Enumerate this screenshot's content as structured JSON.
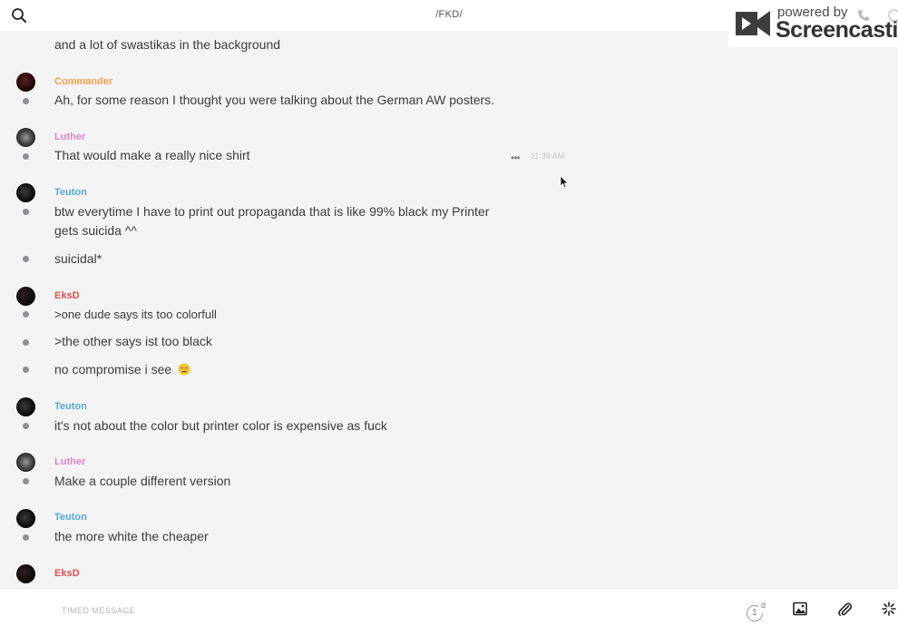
{
  "header": {
    "channel_title": "/FKD/",
    "search_icon": "search-icon"
  },
  "watermark": {
    "powered": "powered by",
    "brand": "Screencastify"
  },
  "messages": [
    {
      "text": "and a lot of swastikas in the background"
    },
    {
      "author": "Commander",
      "color": "#f0a050",
      "lines": [
        "Ah, for some reason I thought you were talking about the German AW posters."
      ]
    },
    {
      "author": "Luther",
      "color": "#d889c4",
      "lines": [
        "That would make a really nice shirt"
      ],
      "time": "11:39 AM"
    },
    {
      "author": "Teuton",
      "color": "#5aa9d6",
      "lines": [
        "btw everytime I have to print out propaganda that is like 99% black my Printer",
        "gets suicida ^^",
        "suicidal*"
      ]
    },
    {
      "author": "EksD",
      "color": "#d9534f",
      "lines": [
        ">one dude says its too colorfull",
        ">the other says ist too black",
        "no compromise i see"
      ]
    },
    {
      "author": "Teuton",
      "color": "#5aa9d6",
      "lines": [
        "it's not about the color but printer color is expensive as fuck"
      ]
    },
    {
      "author": "Luther",
      "color": "#d889c4",
      "lines": [
        "Make a couple different version"
      ]
    },
    {
      "author": "Teuton",
      "color": "#5aa9d6",
      "lines": [
        "the more white the cheaper"
      ]
    },
    {
      "author": "EksD",
      "color": "#d9534f",
      "lines": []
    }
  ],
  "composer": {
    "placeholder": "TIMED MESSAGE",
    "timer_value": "1",
    "timer_unit": "d"
  },
  "icons": {
    "image": "image-icon",
    "attach": "paperclip-icon",
    "effects": "sparkle-icon"
  }
}
